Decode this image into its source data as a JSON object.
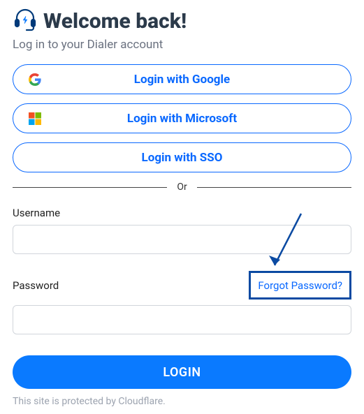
{
  "header": {
    "title": "Welcome back!",
    "subtitle": "Log in to your Dialer account"
  },
  "oauth": {
    "google": "Login with Google",
    "microsoft": "Login with Microsoft",
    "sso": "Login with SSO"
  },
  "divider": "Or",
  "form": {
    "username_label": "Username",
    "password_label": "Password",
    "forgot_password": "Forgot Password?",
    "login_button": "LOGIN"
  },
  "footer": "This site is protected by Cloudflare."
}
